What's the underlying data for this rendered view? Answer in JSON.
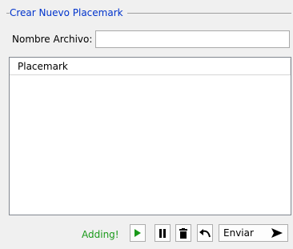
{
  "group": {
    "title": "Crear Nuevo Placemark"
  },
  "form": {
    "name_label": "Nombre Archivo:",
    "name_value": "",
    "name_placeholder": ""
  },
  "list": {
    "columns": [
      "Placemark"
    ]
  },
  "toolbar": {
    "status": "Adding!",
    "status_color": "#1a9a1a",
    "send_label": "Enviar",
    "icons": [
      "play-icon",
      "pause-icon",
      "trash-icon",
      "undo-icon",
      "send-arrow-icon"
    ]
  },
  "colors": {
    "title": "#0033cc",
    "play": "#1a9a1a"
  }
}
